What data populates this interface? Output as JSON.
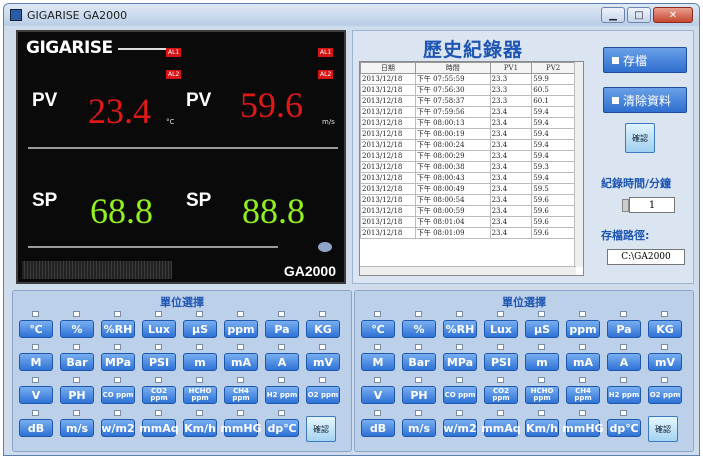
{
  "window": {
    "title": "GIGARISE    GA2000"
  },
  "display": {
    "logo": "GIGARISE",
    "alarms": [
      "AL1",
      "AL2",
      "AL1",
      "AL2"
    ],
    "pv_label": "PV",
    "sp_label": "SP",
    "pv1": "23.4",
    "pv1_unit": "°C",
    "pv2": "59.6",
    "pv2_unit": "m/s",
    "sp1": "68.8",
    "sp2": "88.8",
    "model": "GA2000"
  },
  "recorder": {
    "title": "歷史紀錄器",
    "columns": [
      "日期",
      "時間",
      "PV1",
      "PV2"
    ],
    "rows": [
      [
        "2013/12/18",
        "下午 07:55:59",
        "23.3",
        "59.9"
      ],
      [
        "2013/12/18",
        "下午 07:56:30",
        "23.3",
        "60.5"
      ],
      [
        "2013/12/18",
        "下午 07:58:37",
        "23.3",
        "60.1"
      ],
      [
        "2013/12/18",
        "下午 07:59:56",
        "23.4",
        "59.4"
      ],
      [
        "2013/12/18",
        "下午 08:00:13",
        "23.4",
        "59.4"
      ],
      [
        "2013/12/18",
        "下午 08:00:19",
        "23.4",
        "59.4"
      ],
      [
        "2013/12/18",
        "下午 08:00:24",
        "23.4",
        "59.4"
      ],
      [
        "2013/12/18",
        "下午 08:00:29",
        "23.4",
        "59.4"
      ],
      [
        "2013/12/18",
        "下午 08:00:38",
        "23.4",
        "59.3"
      ],
      [
        "2013/12/18",
        "下午 08:00:43",
        "23.4",
        "59.4"
      ],
      [
        "2013/12/18",
        "下午 08:00:49",
        "23.4",
        "59.5"
      ],
      [
        "2013/12/18",
        "下午 08:00:54",
        "23.4",
        "59.6"
      ],
      [
        "2013/12/18",
        "下午 08:00:59",
        "23.4",
        "59.6"
      ],
      [
        "2013/12/18",
        "下午 08:01:04",
        "23.4",
        "59.6"
      ],
      [
        "2013/12/18",
        "下午 08:01:09",
        "23.4",
        "59.6"
      ]
    ],
    "save_label": "存檔",
    "clear_label": "清除資料",
    "confirm_label": "確認",
    "interval_label": "紀錄時間/分鐘",
    "interval_value": "1",
    "path_label": "存檔路徑:",
    "path_value": "C:\\GA2000"
  },
  "units": {
    "title": "單位選擇",
    "confirm_label": "確認",
    "buttons": [
      "℃",
      "%",
      "%RH",
      "Lux",
      "μS",
      "ppm",
      "Pa",
      "KG",
      "M",
      "Bar",
      "MPa",
      "PSI",
      "m",
      "mA",
      "A",
      "mV",
      "V",
      "PH",
      "CO ppm",
      "CO2 ppm",
      "HCHO ppm",
      "CH4 ppm",
      "H2 ppm",
      "O2 ppm",
      "dB",
      "m/s",
      "w/m2",
      "mmAq",
      "Km/h",
      "mmHG",
      "dp℃"
    ]
  }
}
